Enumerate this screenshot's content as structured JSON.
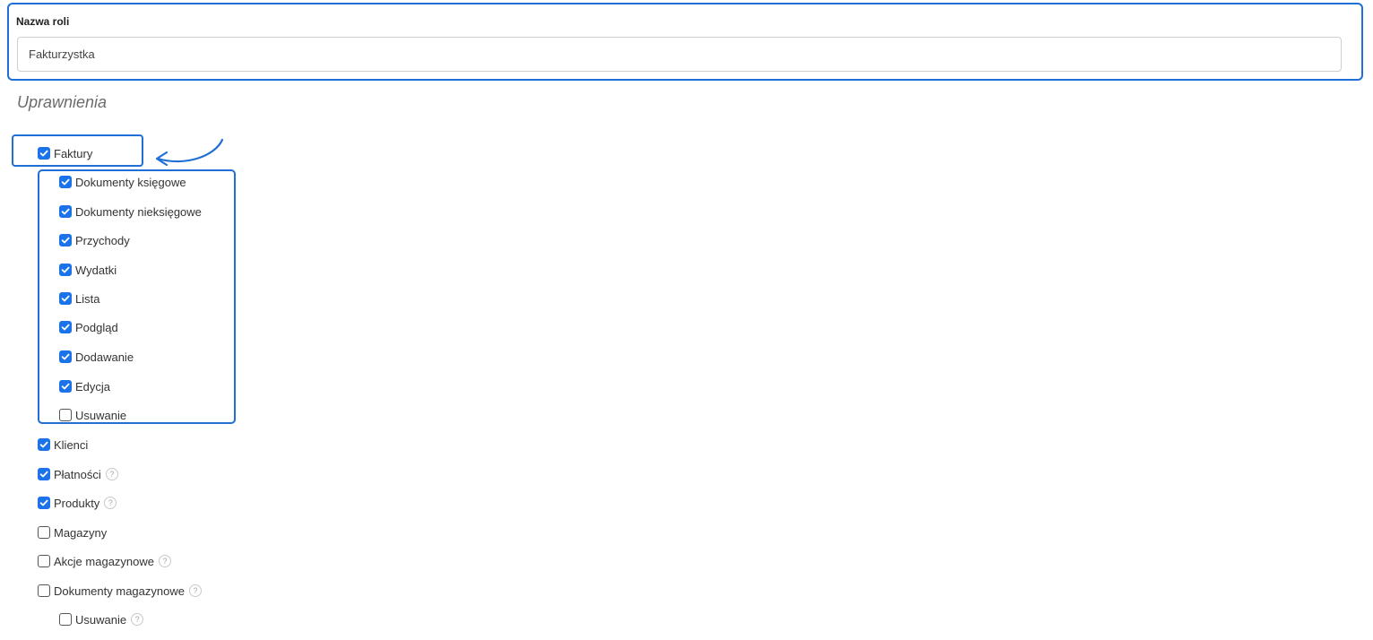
{
  "role": {
    "label": "Nazwa roli",
    "value": "Fakturzystka"
  },
  "permissions_title": "Uprawnienia",
  "help_glyph": "?",
  "colors": {
    "accent": "#1a73e8",
    "highlight": "#1f6fd6"
  },
  "permissions": [
    {
      "label": "Faktury",
      "checked": true,
      "help": false
    },
    {
      "label": "Dokumenty księgowe",
      "checked": true,
      "help": false
    },
    {
      "label": "Dokumenty nieksięgowe",
      "checked": true,
      "help": false
    },
    {
      "label": "Przychody",
      "checked": true,
      "help": false
    },
    {
      "label": "Wydatki",
      "checked": true,
      "help": false
    },
    {
      "label": "Lista",
      "checked": true,
      "help": false
    },
    {
      "label": "Podgląd",
      "checked": true,
      "help": false
    },
    {
      "label": "Dodawanie",
      "checked": true,
      "help": false
    },
    {
      "label": "Edycja",
      "checked": true,
      "help": false
    },
    {
      "label": "Usuwanie",
      "checked": false,
      "help": false
    },
    {
      "label": "Klienci",
      "checked": true,
      "help": false
    },
    {
      "label": "Płatności",
      "checked": true,
      "help": true
    },
    {
      "label": "Produkty",
      "checked": true,
      "help": true
    },
    {
      "label": "Magazyny",
      "checked": false,
      "help": false
    },
    {
      "label": "Akcje magazynowe",
      "checked": false,
      "help": true
    },
    {
      "label": "Dokumenty magazynowe",
      "checked": false,
      "help": true
    },
    {
      "label": "Usuwanie",
      "checked": false,
      "help": true
    }
  ]
}
